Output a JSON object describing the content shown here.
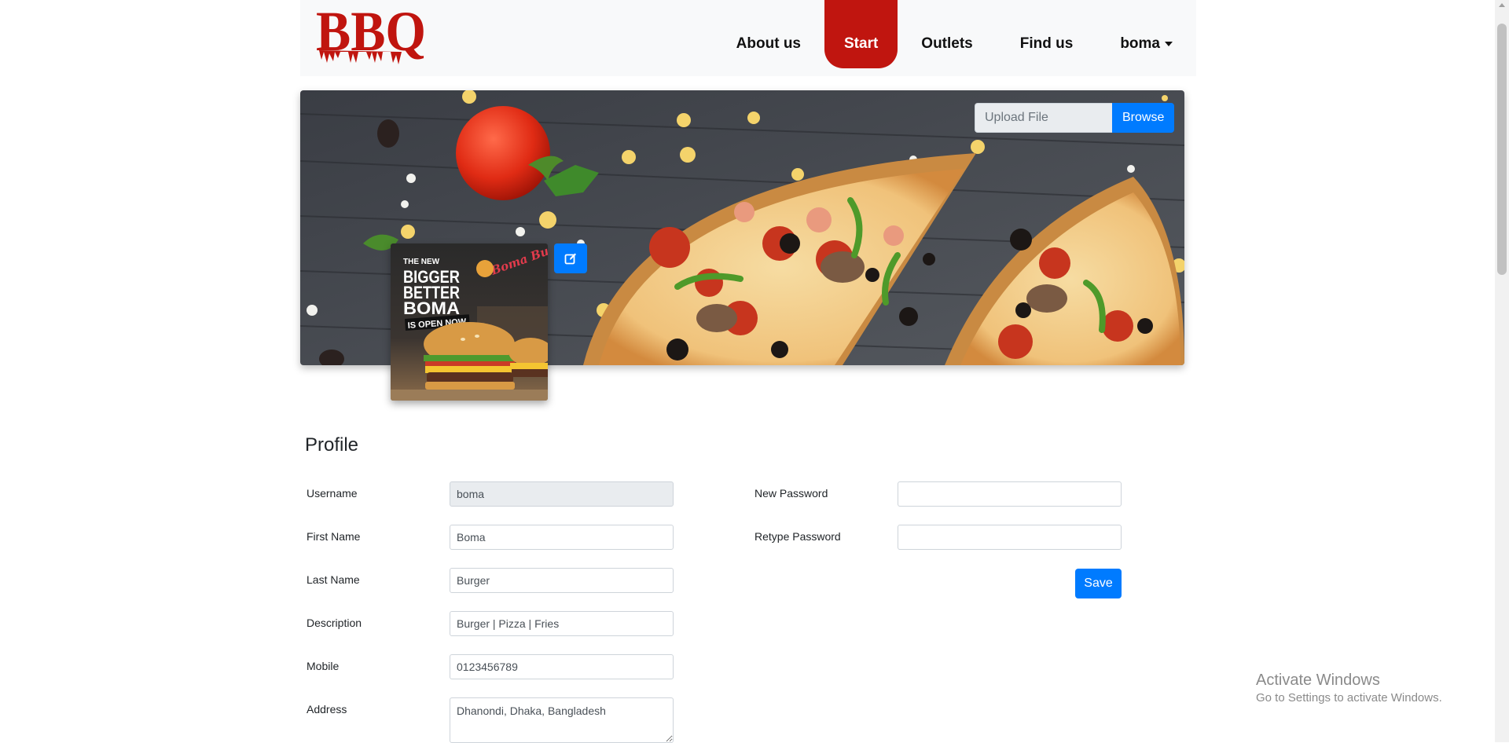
{
  "brand": {
    "logo_text": "BBQ",
    "logo_color": "#c0150f"
  },
  "nav": {
    "items": [
      {
        "label": "About us",
        "active": false
      },
      {
        "label": "Start",
        "active": true
      },
      {
        "label": "Outlets",
        "active": false
      },
      {
        "label": "Find us",
        "active": false
      }
    ],
    "user": "boma"
  },
  "cover": {
    "upload_placeholder": "Upload File",
    "browse_label": "Browse"
  },
  "avatar": {
    "line1": "THE NEW",
    "line2": "BIGGER",
    "line3": "BETTER",
    "line4": "BOMA",
    "line5": "IS OPEN NOW",
    "script": "Boma Burger"
  },
  "profile": {
    "title": "Profile",
    "username_label": "Username",
    "username_value": "boma",
    "first_name_label": "First Name",
    "first_name_value": "Boma",
    "last_name_label": "Last Name",
    "last_name_value": "Burger",
    "description_label": "Description",
    "description_value": "Burger | Pizza | Fries",
    "mobile_label": "Mobile",
    "mobile_value": "0123456789",
    "address_label": "Address",
    "address_value": "Dhanondi, Dhaka, Bangladesh",
    "new_password_label": "New Password",
    "retype_password_label": "Retype Password",
    "save_label": "Save"
  },
  "watermark": {
    "title": "Activate Windows",
    "subtitle": "Go to Settings to activate Windows."
  },
  "colors": {
    "accent": "#007bff",
    "brand": "#c0150f"
  }
}
